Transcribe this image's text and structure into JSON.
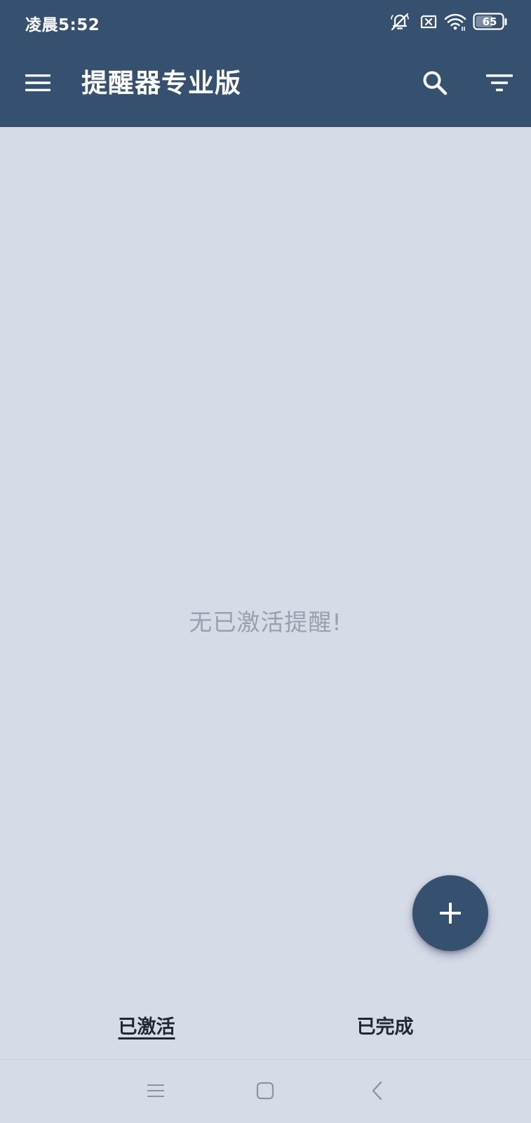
{
  "status_bar": {
    "time": "凌晨5:52",
    "battery_level": "65",
    "icons": [
      "bell-off-icon",
      "sim-off-icon",
      "wifi-icon",
      "battery-icon"
    ]
  },
  "app_bar": {
    "title": "提醒器专业版",
    "icons": [
      "menu-icon",
      "search-icon",
      "filter-icon"
    ]
  },
  "main": {
    "empty_message": "无已激活提醒!"
  },
  "fab": {
    "icon": "plus-icon"
  },
  "tabs": [
    {
      "label": "已激活",
      "active": true
    },
    {
      "label": "已完成",
      "active": false
    }
  ],
  "nav_bar": {
    "icons": [
      "recents-icon",
      "home-icon",
      "back-icon"
    ]
  },
  "colors": {
    "primary": "#36506f",
    "background": "#d6dbe8",
    "empty_text": "#9aa0ad",
    "tab_text": "#222831"
  }
}
